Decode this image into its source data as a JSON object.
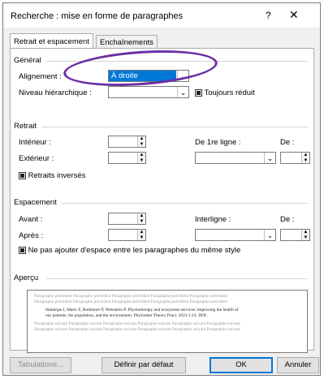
{
  "window": {
    "title": "Recherche : mise en forme de paragraphes",
    "help": "?",
    "close": "✕"
  },
  "tabs": [
    {
      "label": "Retrait et espacement",
      "active": true
    },
    {
      "label": "Enchaînements",
      "active": false
    }
  ],
  "general": {
    "header": "Général",
    "alignment_label": "Alignement :",
    "alignment_value": "À droite",
    "outline_label": "Niveau hiérarchique :",
    "outline_value": "",
    "collapsed_label": "Toujours réduit"
  },
  "indent": {
    "header": "Retrait",
    "inner_label": "Intérieur :",
    "outer_label": "Extérieur :",
    "first_line_label": "De 1re ligne :",
    "by_label": "De :",
    "mirror_label": "Retraits inversés"
  },
  "spacing": {
    "header": "Espacement",
    "before_label": "Avant :",
    "after_label": "Après :",
    "line_spacing_label": "Interligne :",
    "at_label": "De :",
    "no_space_label": "Ne pas ajouter d'espace entre les paragraphes du même style"
  },
  "preview": {
    "header": "Aperçu",
    "previous": [
      "Paragraphe précédent Paragraphe précédent Paragraphe précédent Paragraphe précédent Paragraphe précédent",
      "Paragraphe précédent Paragraphe précédent Paragraphe précédent Paragraphe précédent Paragraphe précédent"
    ],
    "sample": [
      "Stanhope J, Maric F, Rothmore P, Weinstein P. Physiotherapy and ecosystem services: improving the health of",
      "our patients, the population, and the environment. Physiother Theory Pract. 2021;1:14. DOI:"
    ],
    "next": [
      "Paragraphe suivant Paragraphe suivant Paragraphe suivant Paragraphe suivant Paragraphe suivant Paragraphe suivant",
      "Paragraphe suivant Paragraphe suivant Paragraphe suivant Paragraphe suivant Paragraphe suivant Paragraphe suivant"
    ]
  },
  "buttons": {
    "tabs": "Tabulations...",
    "default": "Définir par défaut",
    "ok": "OK",
    "cancel": "Annuler"
  },
  "colors": {
    "selection": "#0078d7",
    "annotation": "#6b2fa5"
  }
}
